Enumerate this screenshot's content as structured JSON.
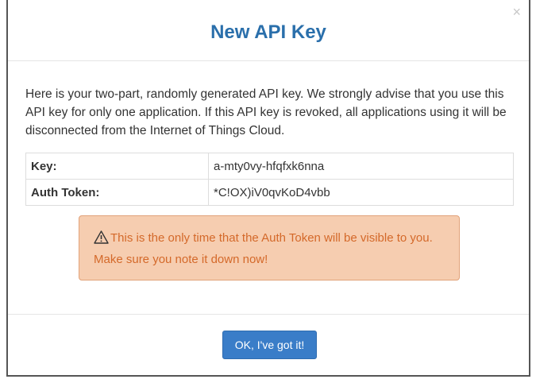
{
  "modal": {
    "title": "New API Key",
    "close_symbol": "×",
    "intro": "Here is your two-part, randomly generated API key. We strongly advise that you use this API key for only one application. If this API key is revoked, all applications using it will be disconnected from the Internet of Things Cloud.",
    "credentials": [
      {
        "label": "Key:",
        "value": "a-mty0vy-hfqfxk6nna"
      },
      {
        "label": "Auth Token:",
        "value": "*C!OX)iV0qvKoD4vbb"
      }
    ],
    "warning": {
      "icon": "warning-icon",
      "text": "This is the only time that the Auth Token will be visible to you. Make sure you note it down now!"
    },
    "ok_button_label": "OK, I've got it!"
  },
  "colors": {
    "title": "#2a6fab",
    "warning_bg": "#f6cdb0",
    "warning_text": "#d4692a",
    "button_bg": "#3a7dc8"
  }
}
